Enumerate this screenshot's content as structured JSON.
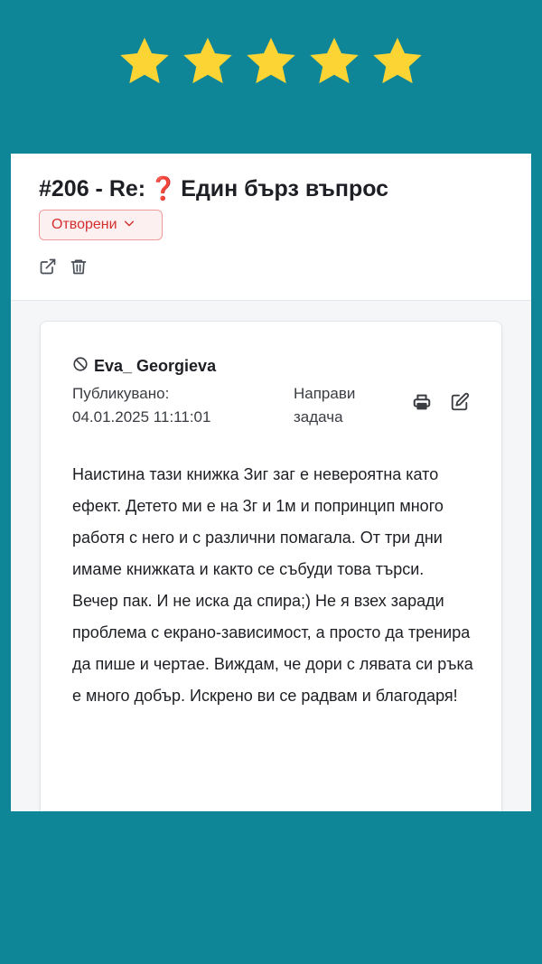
{
  "rating": {
    "stars": 5,
    "max": 5,
    "color": "#fcd535"
  },
  "ticket": {
    "number_prefix": "#206 - Re:",
    "emoji": "❓",
    "subject": "Един бърз въпрос",
    "status_label": "Отворени"
  },
  "post": {
    "author": "Eva_ Georgieva",
    "published_label": "Публикувано:",
    "published_date": "04.01.2025 11:11:01",
    "make_task_line1": "Направи",
    "make_task_line2": "задача",
    "message": "Наистина тази книжка Зиг заг е невероятна като ефект. Детето ми е на 3г и 1м и попринцип много работя с него и с различни помагала. От три дни  имаме книжката и както се събуди това търси. Вечер пак. И не иска да спира;) Не я взех заради проблема с екрано-зависимост, а просто да тренира да пише и чертае.  Виждам, че дори с лявата си ръка е много добър. Искрено ви се радвам и благодаря!"
  },
  "colors": {
    "background": "#0f8598",
    "status_red": "#d32f2f"
  },
  "icons": {
    "header": [
      "external-link-icon",
      "trash-icon"
    ],
    "post": [
      "print-icon",
      "edit-icon"
    ],
    "author": "ban-icon"
  }
}
